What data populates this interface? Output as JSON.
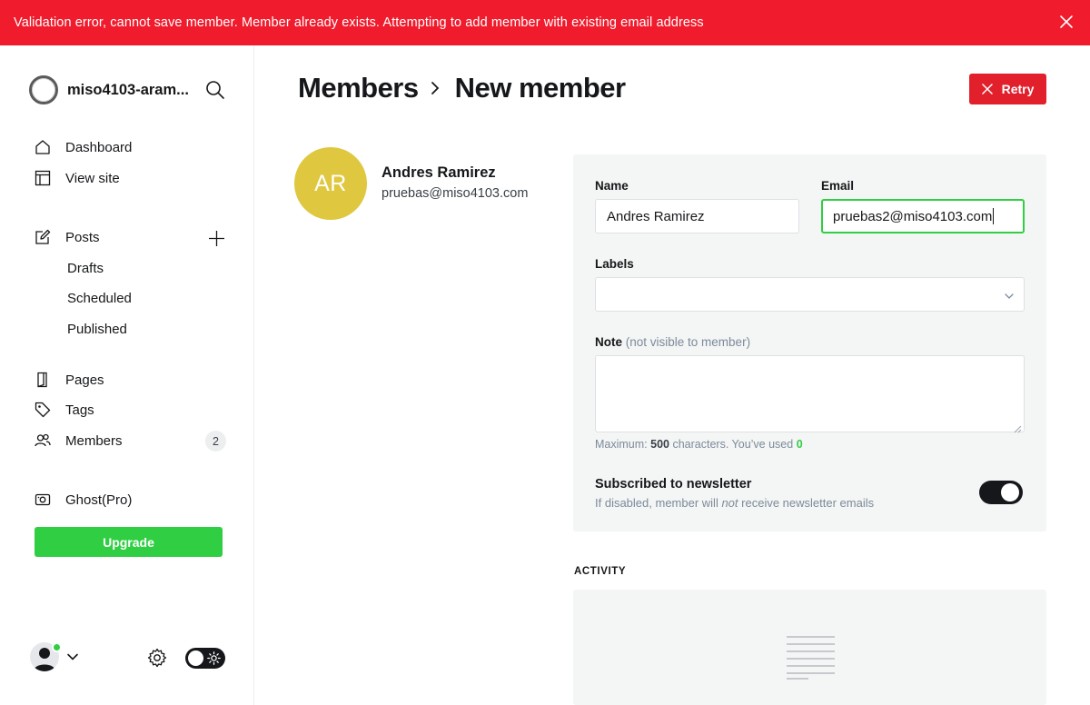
{
  "banner": {
    "message": "Validation error, cannot save member. Member already exists. Attempting to add member with existing email address",
    "color": "#f01b2c"
  },
  "sidebar": {
    "site_name": "miso4103-aram...",
    "nav": {
      "dashboard": "Dashboard",
      "view_site": "View site",
      "posts": "Posts",
      "drafts": "Drafts",
      "scheduled": "Scheduled",
      "published": "Published",
      "pages": "Pages",
      "tags": "Tags",
      "members": "Members",
      "members_count": "2",
      "ghost_pro": "Ghost(Pro)"
    },
    "upgrade_label": "Upgrade"
  },
  "header": {
    "breadcrumb_parent": "Members",
    "breadcrumb_current": "New member",
    "retry_label": "Retry"
  },
  "member": {
    "initials": "AR",
    "name": "Andres Ramirez",
    "email": "pruebas@miso4103.com",
    "avatar_color": "#dfc73f"
  },
  "form": {
    "name_label": "Name",
    "name_value": "Andres Ramirez",
    "email_label": "Email",
    "email_value": "pruebas2@miso4103.com",
    "labels_label": "Labels",
    "note_label": "Note",
    "note_hint": "(not visible to member)",
    "max_prefix": "Maximum:",
    "max_count": "500",
    "max_middle": "characters. You’ve used",
    "used_count": "0",
    "newsletter_title": "Subscribed to newsletter",
    "newsletter_desc_pre": "If disabled, member will",
    "newsletter_desc_em": "not",
    "newsletter_desc_post": "receive newsletter emails",
    "newsletter_enabled": true
  },
  "activity": {
    "heading": "ACTIVITY"
  },
  "colors": {
    "accent_green": "#30cf43",
    "danger_red": "#e1202c",
    "dark": "#15171a"
  }
}
